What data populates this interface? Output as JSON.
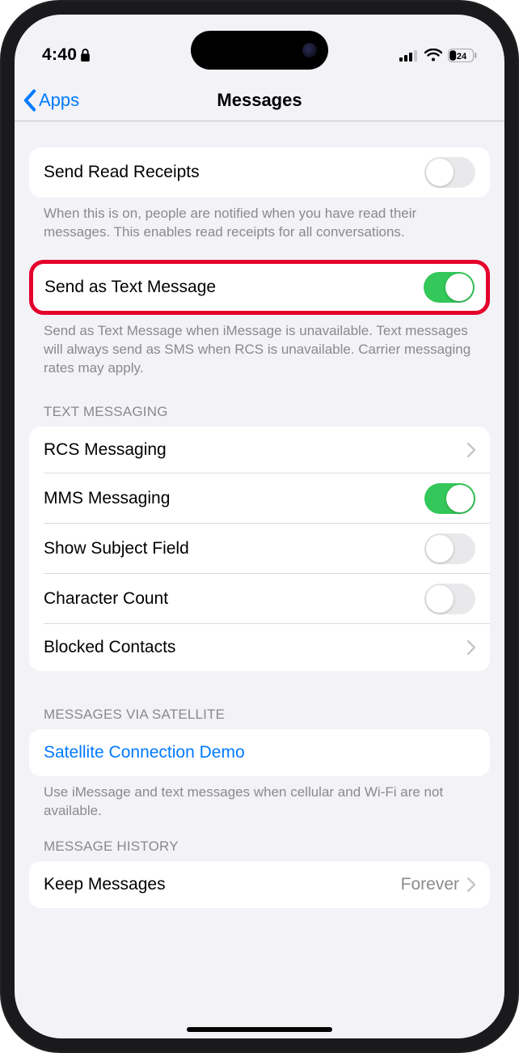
{
  "status": {
    "time": "4:40",
    "battery": "24"
  },
  "nav": {
    "back": "Apps",
    "title": "Messages"
  },
  "readReceipts": {
    "label": "Send Read Receipts",
    "footer": "When this is on, people are notified when you have read their messages. This enables read receipts for all conversations."
  },
  "sendAsText": {
    "label": "Send as Text Message",
    "footer": "Send as Text Message when iMessage is unavailable. Text messages will always send as SMS when RCS is unavailable. Carrier messaging rates may apply."
  },
  "textMessaging": {
    "header": "TEXT MESSAGING",
    "rcs": "RCS Messaging",
    "mms": "MMS Messaging",
    "subject": "Show Subject Field",
    "charCount": "Character Count",
    "blocked": "Blocked Contacts"
  },
  "satellite": {
    "header": "MESSAGES VIA SATELLITE",
    "demo": "Satellite Connection Demo",
    "footer": "Use iMessage and text messages when cellular and Wi-Fi are not available."
  },
  "history": {
    "header": "MESSAGE HISTORY",
    "keep": "Keep Messages",
    "keepValue": "Forever"
  }
}
